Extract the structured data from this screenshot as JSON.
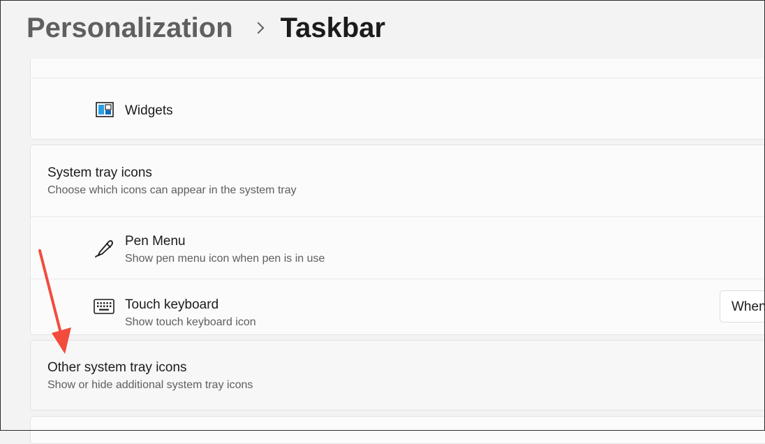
{
  "breadcrumb": {
    "parent": "Personalization",
    "current": "Taskbar"
  },
  "taskbar_items": {
    "widgets": {
      "label": "Widgets",
      "icon": "widgets-icon"
    }
  },
  "system_tray": {
    "title": "System tray icons",
    "subtitle": "Choose which icons can appear in the system tray",
    "items": [
      {
        "label": "Pen Menu",
        "description": "Show pen menu icon when pen is in use",
        "icon": "pen-icon"
      },
      {
        "label": "Touch keyboard",
        "description": "Show touch keyboard icon",
        "icon": "keyboard-icon",
        "dropdown_value": "When"
      }
    ]
  },
  "other_tray": {
    "title": "Other system tray icons",
    "subtitle": "Show or hide additional system tray icons"
  },
  "colors": {
    "accent": "#0078d4",
    "annotation_arrow": "#f24c3d"
  }
}
